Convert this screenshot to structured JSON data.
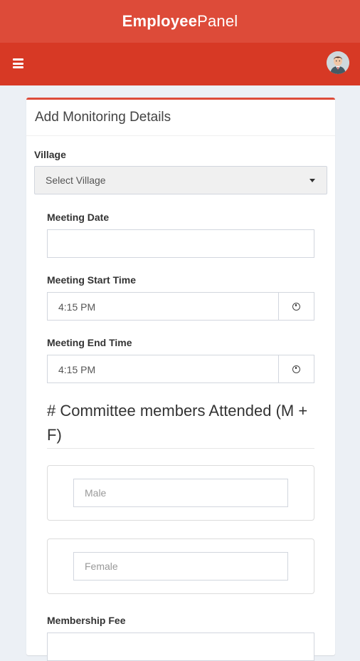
{
  "app": {
    "brand_bold": "Employee",
    "brand_light": "Panel"
  },
  "navbar": {
    "menu_icon": "hamburger-menu-icon",
    "avatar": "user-avatar"
  },
  "form": {
    "title": "Add Monitoring Details",
    "village": {
      "label": "Village",
      "value": "Select Village"
    },
    "meeting_date": {
      "label": "Meeting Date",
      "value": ""
    },
    "meeting_start_time": {
      "label": "Meeting Start Time",
      "value": "4:15 PM",
      "icon": "clock-icon"
    },
    "meeting_end_time": {
      "label": "Meeting End Time",
      "value": "4:15 PM",
      "icon": "clock-icon"
    },
    "committee_section_title": "# Committee members Attended (M + F)",
    "male": {
      "placeholder": "Male"
    },
    "female": {
      "placeholder": "Female"
    },
    "membership_fee": {
      "label": "Membership Fee"
    }
  },
  "colors": {
    "header": "#dd4b39",
    "navbar": "#d73925",
    "background": "#ecf0f5"
  }
}
